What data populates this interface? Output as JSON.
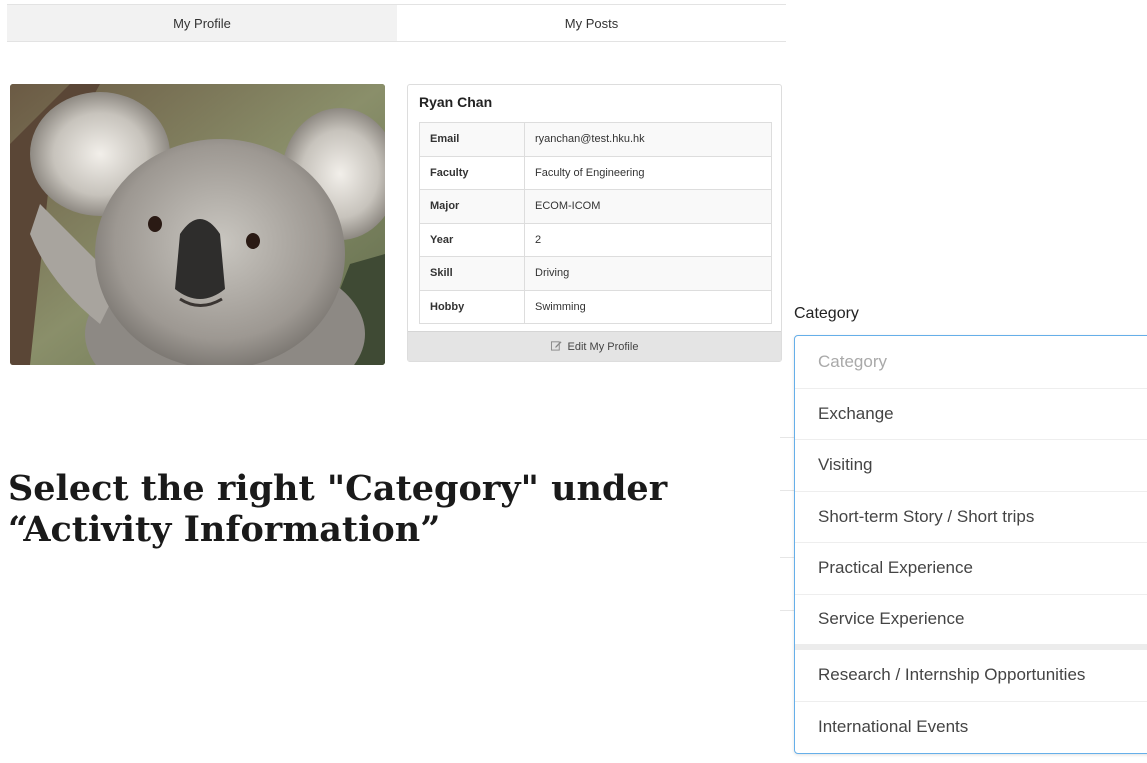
{
  "tabs": [
    {
      "label": "My Profile"
    },
    {
      "label": "My Posts"
    }
  ],
  "profile": {
    "name": "Ryan Chan",
    "fields": [
      {
        "label": "Email",
        "value": "ryanchan@test.hku.hk"
      },
      {
        "label": "Faculty",
        "value": "Faculty of Engineering"
      },
      {
        "label": "Major",
        "value": "ECOM-ICOM"
      },
      {
        "label": "Year",
        "value": "2"
      },
      {
        "label": "Skill",
        "value": "Driving"
      },
      {
        "label": "Hobby",
        "value": "Swimming"
      }
    ],
    "edit_label": "Edit My Profile",
    "edit_icon": "pencil-square-icon"
  },
  "instruction": {
    "line1": "Select the right \"Category\" under",
    "line2": "“Activity Information”"
  },
  "category": {
    "label": "Category",
    "placeholder": "Category",
    "options": [
      "Exchange",
      "Visiting",
      "Short-term Story / Short trips",
      "Practical Experience",
      "Service Experience",
      "Research / Internship Opportunities",
      "International Events"
    ]
  },
  "colors": {
    "dropdown_border": "#66afe9",
    "tab_active_bg": "#f2f2f2",
    "edit_button_bg": "#e4e4e4"
  }
}
